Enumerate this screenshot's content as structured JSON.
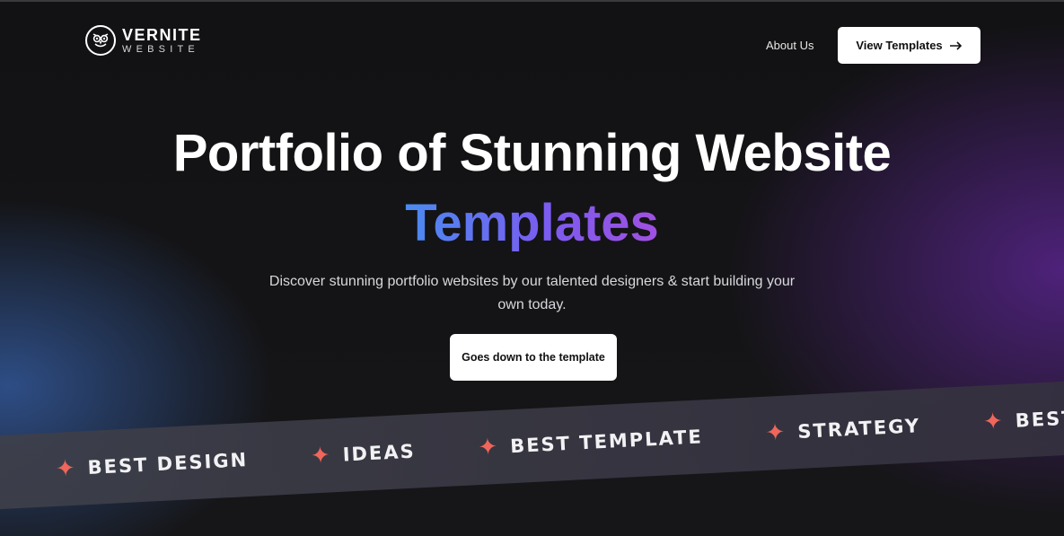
{
  "brand": {
    "name": "VERNITE",
    "subtitle": "WEBSITE",
    "icon": "owl-logo-icon"
  },
  "nav": {
    "about_label": "About Us",
    "cta_label": "View Templates",
    "cta_icon": "arrow-right-icon"
  },
  "hero": {
    "title": "Portfolio of Stunning Website",
    "title_accent": "Templates",
    "description": "Discover stunning portfolio websites by our talented designers & start building your own today.",
    "cta_label": "Goes down to the template"
  },
  "marquee": {
    "icon": "sparkle-icon",
    "items": [
      "Best Design",
      "Ideas",
      "Best Template",
      "Strategy",
      "Best"
    ]
  },
  "colors": {
    "accent_gradient_start": "#4a8bf0",
    "accent_gradient_end": "#a050e0",
    "sparkle": "#f0665a",
    "background": "#141416"
  }
}
